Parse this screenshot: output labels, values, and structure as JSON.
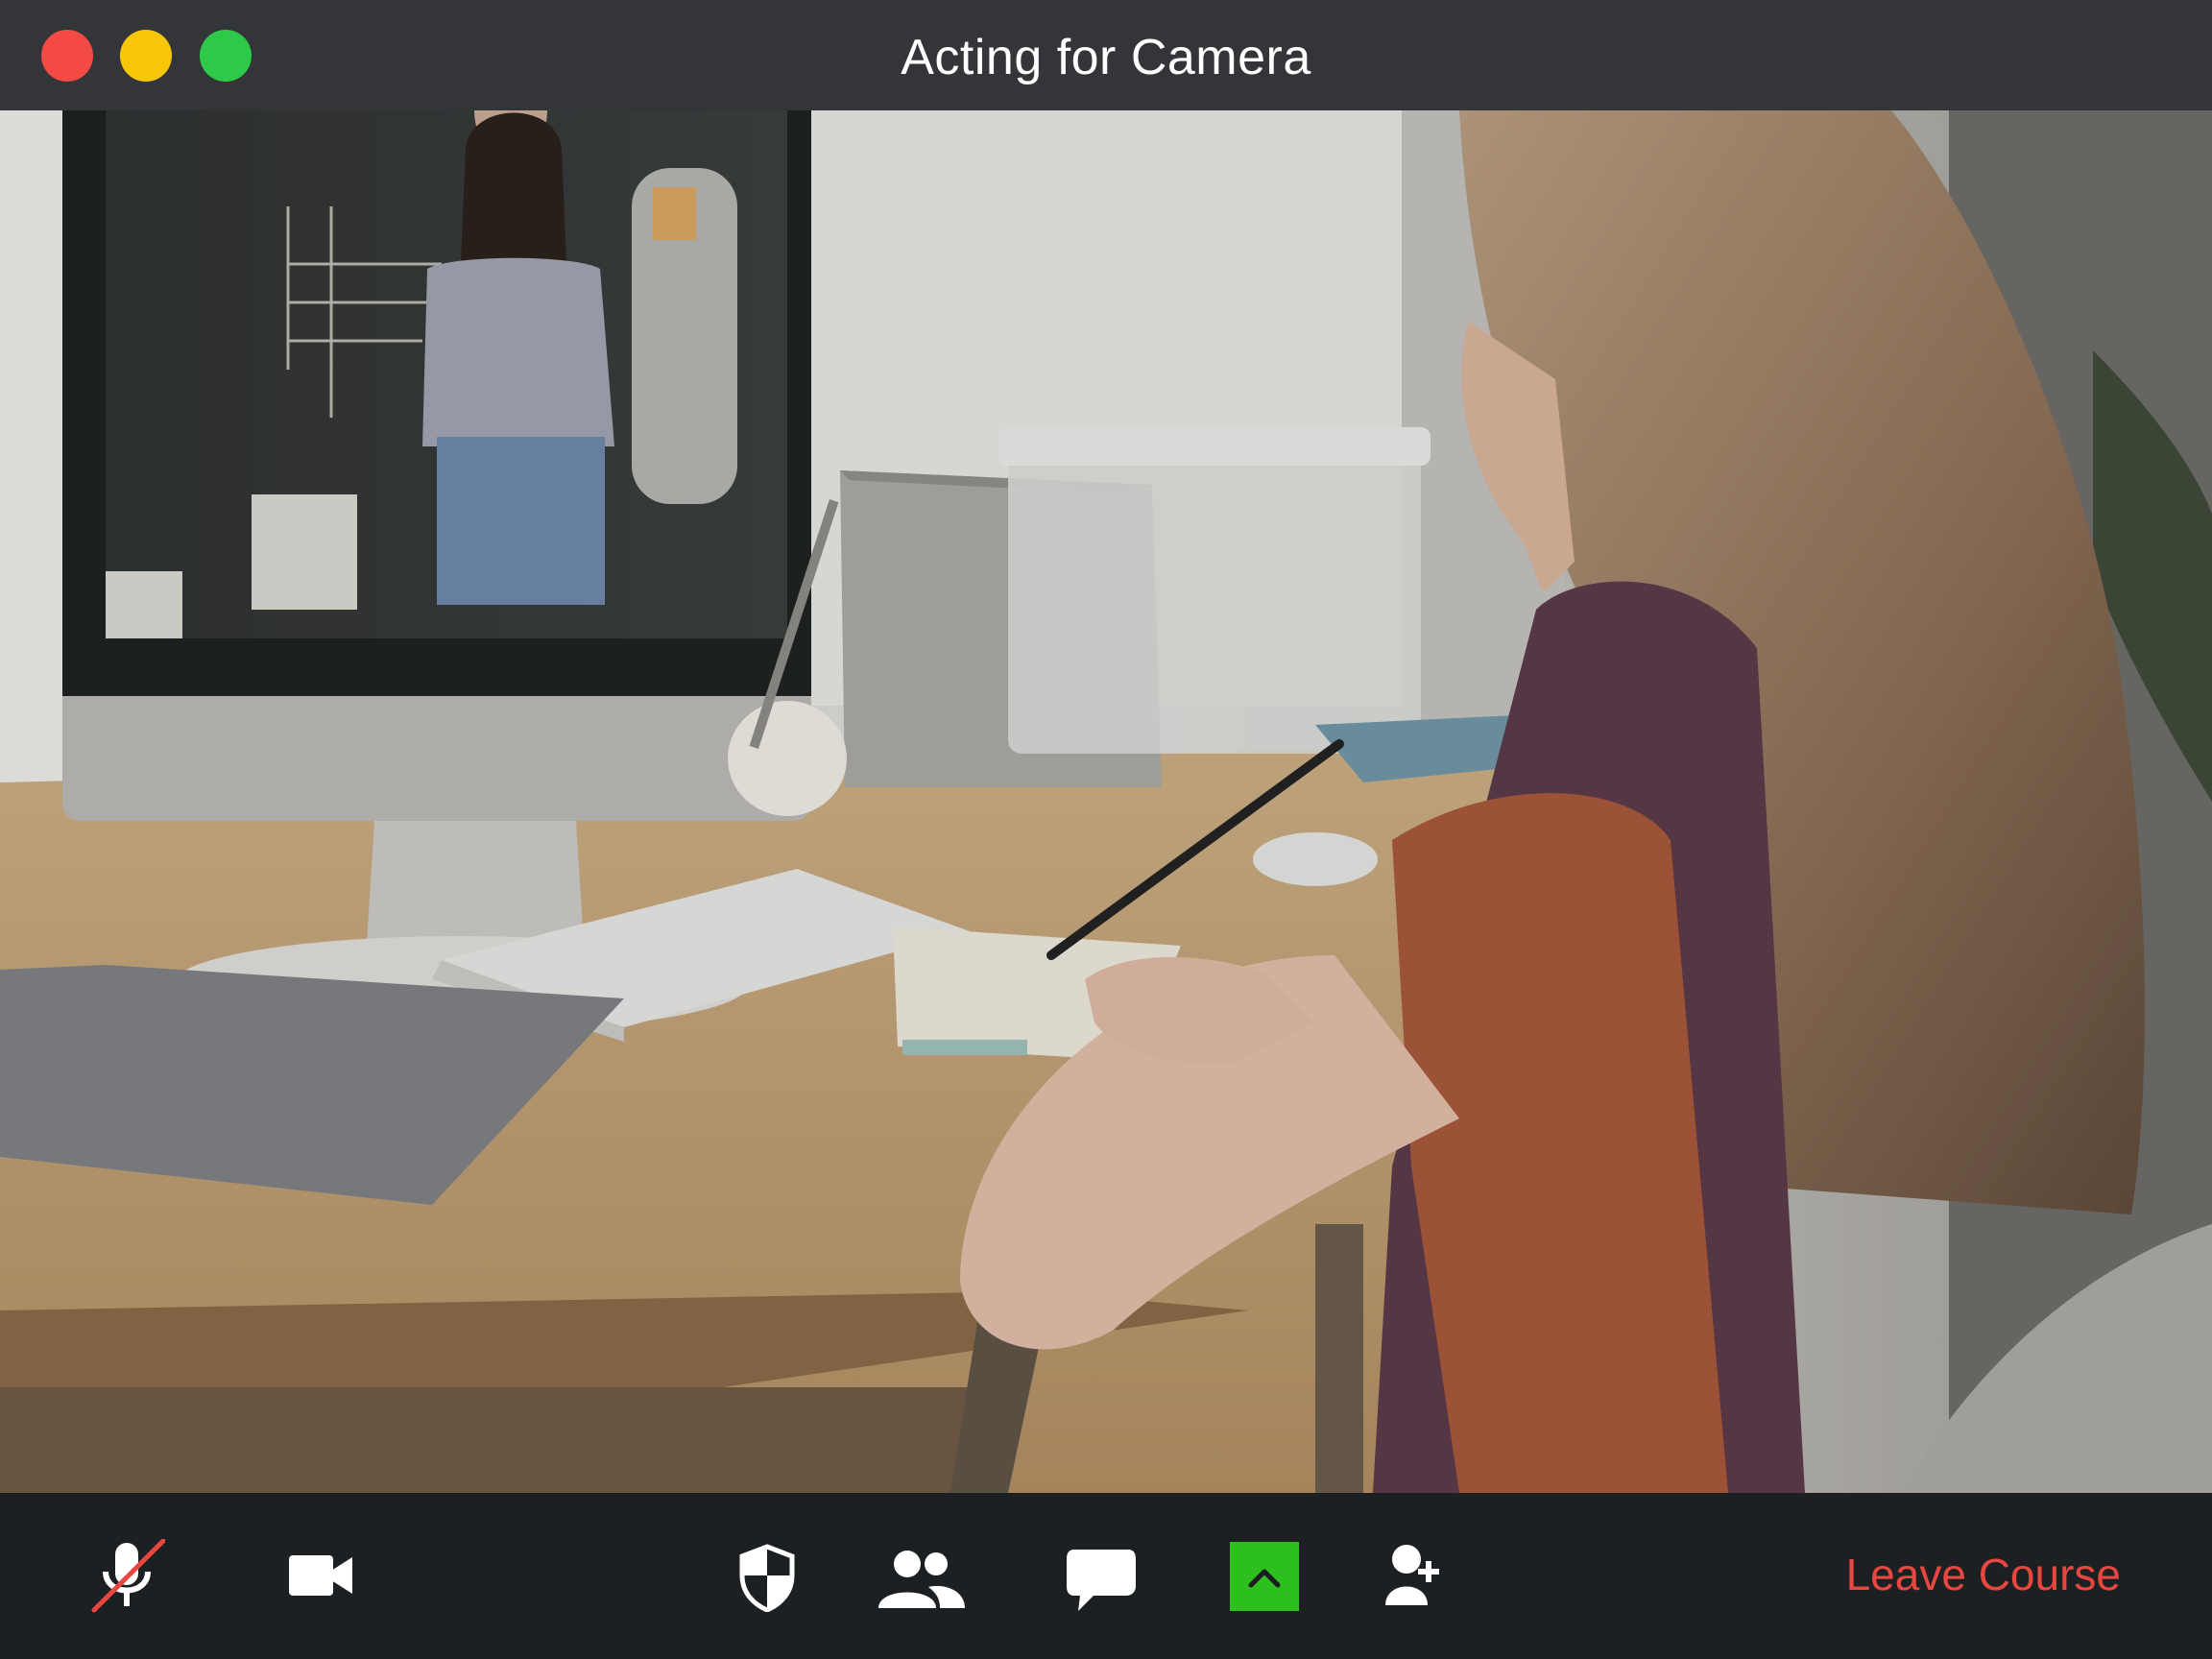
{
  "window": {
    "title": "Acting for Camera",
    "traffic_lights": {
      "close_color": "#f34b43",
      "minimize_color": "#f7c707",
      "zoom_color": "#2fc94a"
    }
  },
  "video": {
    "scene": "student-at-desk-watching-online-class"
  },
  "toolbar": {
    "mute_icon": "microphone-muted-icon",
    "video_icon": "video-camera-icon",
    "security_icon": "shield-icon",
    "participants_icon": "participants-icon",
    "chat_icon": "chat-bubble-icon",
    "share_icon": "share-screen-icon",
    "share_color": "#2dbf1d",
    "invite_icon": "add-person-icon",
    "leave_label": "Leave Course",
    "leave_color": "#e8473f",
    "icon_color": "#ffffff",
    "muted_slash_color": "#e8473f"
  }
}
